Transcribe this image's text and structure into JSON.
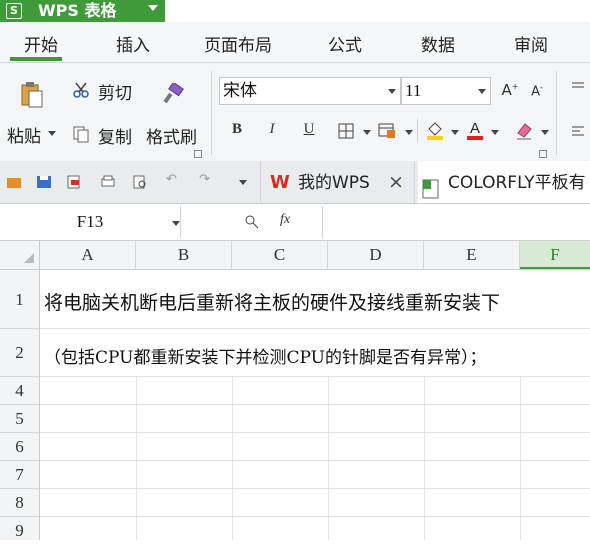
{
  "app": {
    "logo": "S",
    "title": "WPS 表格"
  },
  "tabs": [
    "开始",
    "插入",
    "页面布局",
    "公式",
    "数据",
    "审阅"
  ],
  "ribbon": {
    "paste": "粘贴",
    "cut": "剪切",
    "copy": "复制",
    "format_painter": "格式刷",
    "font_name": "宋体",
    "font_size": "11",
    "bold": "B",
    "italic": "I",
    "underline": "U"
  },
  "doc_tabs": [
    {
      "title": "我的WPS",
      "close": "×"
    },
    {
      "title": "COLORFLY平板有"
    }
  ],
  "formula_bar": {
    "name_box": "F13",
    "fx": "fx"
  },
  "columns": [
    "A",
    "B",
    "C",
    "D",
    "E",
    "F"
  ],
  "rows": [
    "1",
    "2",
    "4",
    "5",
    "6",
    "7",
    "8",
    "9"
  ],
  "cells": {
    "A1": "将电脑关机断电后重新将主板的硬件及接线重新安装下",
    "A2": "（包括CPU都重新安装下并检测CPU的针脚是否有异常）；"
  },
  "colors": {
    "accent": "#3f9b3a",
    "selected_col_bg": "#d7ead3"
  }
}
